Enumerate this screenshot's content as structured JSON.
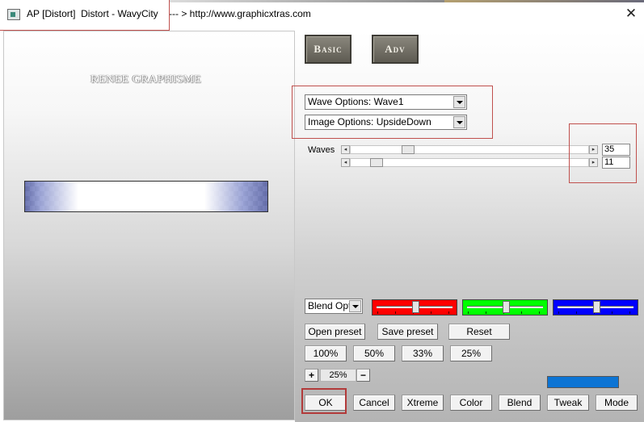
{
  "window": {
    "title": "AP [Distort]  Distort - WavyCity    --- > http://www.graphicxtras.com",
    "close_glyph": "✕"
  },
  "preview": {
    "watermark": "RENEE GRAPHISME"
  },
  "mode_buttons": {
    "basic": "Basic",
    "adv": "Adv"
  },
  "selects": {
    "wave_options": "Wave Options: Wave1",
    "image_options": "Image Options: UpsideDown",
    "blend_options": "Blend Optio"
  },
  "sliders": {
    "label": "Waves",
    "left_arrow": "◂",
    "right_arrow": "▸",
    "items": [
      {
        "value": "35",
        "fraction": 0.23
      },
      {
        "value": "11",
        "fraction": 0.09
      }
    ]
  },
  "color_sliders": [
    {
      "name": "red",
      "color": "#ff0000",
      "fraction": 0.5
    },
    {
      "name": "green",
      "color": "#00ff00",
      "fraction": 0.5
    },
    {
      "name": "blue",
      "color": "#0000ff",
      "fraction": 0.5
    }
  ],
  "preset_buttons": {
    "open": "Open preset",
    "save": "Save preset",
    "reset": "Reset"
  },
  "zoom_buttons": [
    "100%",
    "50%",
    "33%",
    "25%"
  ],
  "zoom_stepper": {
    "plus": "+",
    "value": "25%",
    "minus": "−"
  },
  "accent_color": "#0c74d4",
  "bottom_buttons": [
    "OK",
    "Cancel",
    "Xtreme",
    "Color",
    "Blend",
    "Tweak",
    "Mode"
  ]
}
